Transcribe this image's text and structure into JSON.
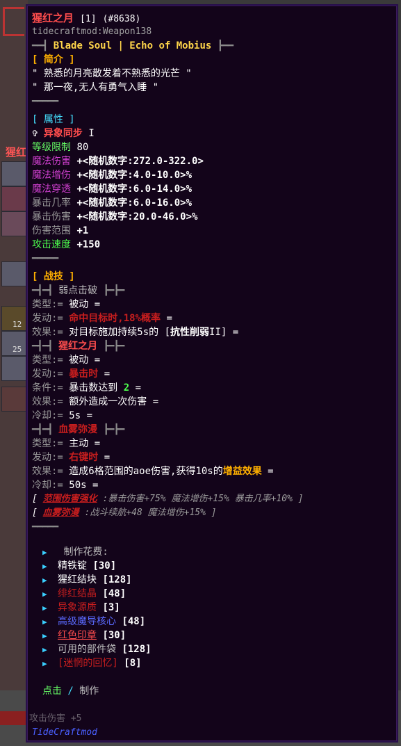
{
  "background": {
    "left_title": "猩红",
    "slot_counts": [
      "12",
      "25"
    ],
    "bottom_text": "攻击伤害 +5"
  },
  "tooltip": {
    "title": "猩红之月",
    "title_count": "[1]",
    "title_id": "(#8638)",
    "registry_id": "tidecraftmod:Weapon138",
    "series_line": "Blade Soul | Echo of Mobius",
    "series_prefix": "━━┫",
    "series_suffix": "┣━━",
    "intro_header": "[ 简介 ]",
    "intro_lines": [
      "\" 熟悉的月亮散发着不熟悉的光芒 \"",
      "\" 那一夜,无人有勇气入睡 \""
    ],
    "divider": "━━━━━",
    "attr_header": "[ 属性 ]",
    "attr_anomaly_symbol": "✞",
    "attr_anomaly_label": "异象同步",
    "attr_anomaly_level": "I",
    "level_limit_label": "等级限制",
    "level_limit_value": "80",
    "stats": [
      {
        "label": "魔法伤害",
        "value": "+<随机数字:272.0-322.0>",
        "color": "#d040d0"
      },
      {
        "label": "魔法增伤",
        "value": "+<随机数字:4.0-10.0>%",
        "color": "#d040d0"
      },
      {
        "label": "魔法穿透",
        "value": "+<随机数字:6.0-14.0>%",
        "color": "#d040d0"
      },
      {
        "label": "暴击几率",
        "value": "+<随机数字:6.0-16.0>%",
        "color": "#9a9a9a"
      },
      {
        "label": "暴击伤害",
        "value": "+<随机数字:20.0-46.0>%",
        "color": "#9a9a9a"
      },
      {
        "label": "伤害范围",
        "value": "+1",
        "color": "#9a9a9a"
      },
      {
        "label": "攻击速度",
        "value": "+150",
        "color": "#4dff4d"
      }
    ],
    "skills_header": "[ 战技 ]",
    "skill_dash": "━┫━┫",
    "skill_dash_r": "┣━┣━",
    "skill1": {
      "name": "弱点击破",
      "type_label": "类型:=",
      "type_value": "被动 =",
      "trigger_label": "发动:=",
      "trigger_value": "命中目标时,18%概率",
      "trigger_tail": " =",
      "effect_label": "效果:=",
      "effect_value": "对目标施加持续5s的 [",
      "effect_bold": "抗性削弱",
      "effect_tail": "II] ="
    },
    "skill2": {
      "name": "猩红之月",
      "type_label": "类型:=",
      "type_value": "被动 =",
      "trigger_label": "发动:=",
      "trigger_value": "暴击时",
      "trigger_tail": " =",
      "cond_label": "条件:=",
      "cond_value": "暴击数达到 ",
      "cond_num": "2",
      "cond_tail": "  =",
      "effect_label": "效果:=",
      "effect_value": "额外造成一次伤害  =",
      "cd_label": "冷却:=",
      "cd_value": "5s ="
    },
    "skill3": {
      "name": "血雾弥漫",
      "type_label": "类型:=",
      "type_value": "主动 =",
      "trigger_label": "发动:=",
      "trigger_value": "右键时",
      "trigger_tail": " =",
      "effect_label": "效果:=",
      "effect_value": "造成6格范围的aoe伤害,获得10s的",
      "effect_gold": "增益效果",
      "effect_tail": "  =",
      "cd_label": "冷却:=",
      "cd_value": "50s ="
    },
    "enhance1_open": "[",
    "enhance1_name": "范围伤害强化",
    "enhance1_desc": ":暴击伤害+75% 魔法增伤+15% 暴击几率+10% ]",
    "enhance2_open": "[",
    "enhance2_name": "血雾弥漫",
    "enhance2_desc": ":战斗续航+48 魔法增伤+15% ]",
    "craft_header": "制作花费:",
    "craft_items": [
      {
        "name": "精铁锭",
        "count": "[30]",
        "color": "#ffffff",
        "underline": false
      },
      {
        "name": "猩红结块",
        "count": "[128]",
        "color": "#ffffff",
        "underline": false
      },
      {
        "name": "绯红结晶",
        "count": "[48]",
        "color": "#c81e1e",
        "underline": false
      },
      {
        "name": "异象源质",
        "count": "[3]",
        "color": "#c81e1e",
        "underline": false
      },
      {
        "name": "高级魔导核心",
        "count": "[48]",
        "color": "#5a6aff",
        "underline": false
      },
      {
        "name": "红色印章",
        "count": "[30]",
        "color": "#ff4d4d",
        "underline": true
      },
      {
        "name": "可用的部件袋",
        "count": "[128]",
        "color": "#bdbdbd",
        "underline": false
      },
      {
        "name": "[迷惘的回忆]",
        "count": "[8]",
        "color": "#c81e1e",
        "underline": false
      }
    ],
    "action_click": "点击",
    "action_sep": " / ",
    "action_craft": "制作",
    "mod_name": "TideCraftmod"
  }
}
